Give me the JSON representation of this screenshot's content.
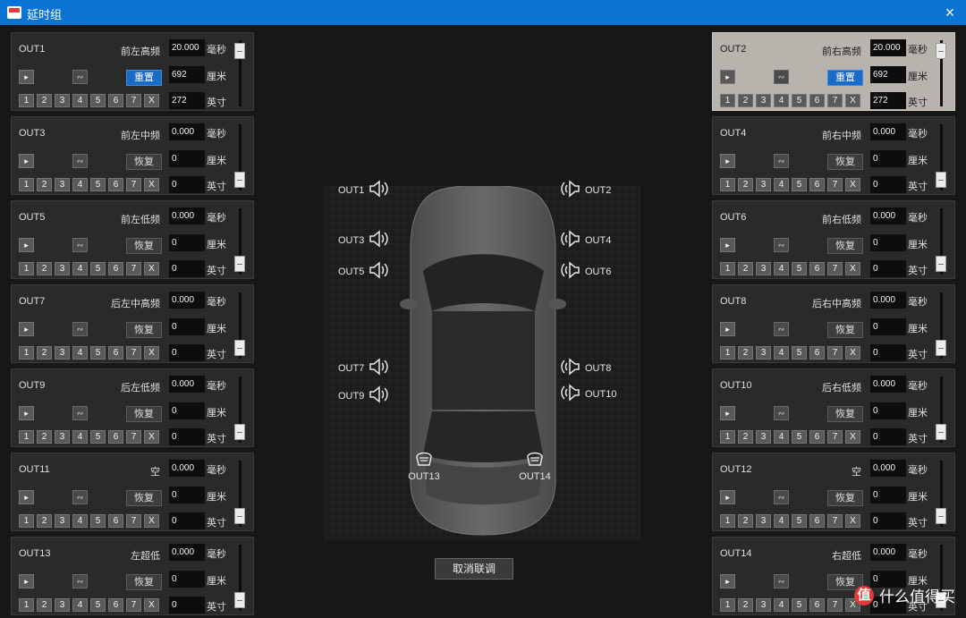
{
  "window": {
    "title": "延时组",
    "close_icon": "×"
  },
  "panels_left": [
    {
      "out": "OUT1",
      "position": "前左高频",
      "ms": "20.000",
      "cm": "692",
      "inch": "272",
      "action": "重置",
      "action_primary": true,
      "slider": 0.95
    },
    {
      "out": "OUT3",
      "position": "前左中频",
      "ms": "0.000",
      "cm": "0",
      "inch": "0",
      "action": "恢复",
      "action_primary": false,
      "slider": 0.05
    },
    {
      "out": "OUT5",
      "position": "前左低频",
      "ms": "0.000",
      "cm": "0",
      "inch": "0",
      "action": "恢复",
      "action_primary": false,
      "slider": 0.05
    },
    {
      "out": "OUT7",
      "position": "后左中高频",
      "ms": "0.000",
      "cm": "0",
      "inch": "0",
      "action": "恢复",
      "action_primary": false,
      "slider": 0.05
    },
    {
      "out": "OUT9",
      "position": "后左低频",
      "ms": "0.000",
      "cm": "0",
      "inch": "0",
      "action": "恢复",
      "action_primary": false,
      "slider": 0.05
    },
    {
      "out": "OUT11",
      "position": "空",
      "ms": "0.000",
      "cm": "0",
      "inch": "0",
      "action": "恢复",
      "action_primary": false,
      "slider": 0.05
    },
    {
      "out": "OUT13",
      "position": "左超低",
      "ms": "0.000",
      "cm": "0",
      "inch": "0",
      "action": "恢复",
      "action_primary": false,
      "slider": 0.05
    }
  ],
  "panels_right": [
    {
      "out": "OUT2",
      "position": "前右高频",
      "ms": "20.000",
      "cm": "692",
      "inch": "272",
      "action": "重置",
      "action_primary": true,
      "slider": 0.95,
      "highlight": true
    },
    {
      "out": "OUT4",
      "position": "前右中频",
      "ms": "0.000",
      "cm": "0",
      "inch": "0",
      "action": "恢复",
      "action_primary": false,
      "slider": 0.05
    },
    {
      "out": "OUT6",
      "position": "前右低频",
      "ms": "0.000",
      "cm": "0",
      "inch": "0",
      "action": "恢复",
      "action_primary": false,
      "slider": 0.05
    },
    {
      "out": "OUT8",
      "position": "后右中高频",
      "ms": "0.000",
      "cm": "0",
      "inch": "0",
      "action": "恢复",
      "action_primary": false,
      "slider": 0.05
    },
    {
      "out": "OUT10",
      "position": "后右低频",
      "ms": "0.000",
      "cm": "0",
      "inch": "0",
      "action": "恢复",
      "action_primary": false,
      "slider": 0.05
    },
    {
      "out": "OUT12",
      "position": "空",
      "ms": "0.000",
      "cm": "0",
      "inch": "0",
      "action": "恢复",
      "action_primary": false,
      "slider": 0.05
    },
    {
      "out": "OUT14",
      "position": "右超低",
      "ms": "0.000",
      "cm": "0",
      "inch": "0",
      "action": "恢复",
      "action_primary": false,
      "slider": 0.05
    }
  ],
  "units": {
    "ms": "毫秒",
    "cm": "厘米",
    "inch": "英寸"
  },
  "link_buttons": [
    "1",
    "2",
    "3",
    "4",
    "5",
    "6",
    "7",
    "X"
  ],
  "icons": {
    "mute": "speaker-icon",
    "phase": "phase-icon"
  },
  "car_speakers": {
    "left": [
      "OUT1",
      "OUT3",
      "OUT5",
      "OUT7",
      "OUT9"
    ],
    "right": [
      "OUT2",
      "OUT4",
      "OUT6",
      "OUT8",
      "OUT10"
    ],
    "sub": [
      "OUT13",
      "OUT14"
    ]
  },
  "unlink_button": "取消联调",
  "watermark": {
    "badge": "值",
    "text": "什么值得买"
  },
  "colors": {
    "titlebar": "#0a73d4",
    "primary_button": "#1a6bc7",
    "highlight_panel": "#b9b3ad"
  }
}
